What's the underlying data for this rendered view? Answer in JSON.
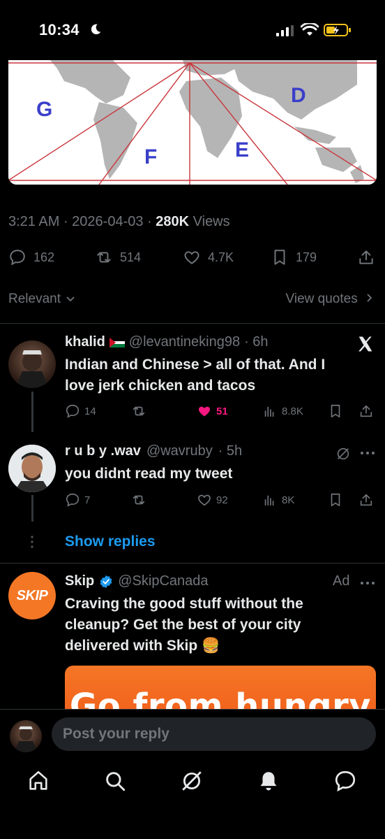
{
  "status": {
    "time": "10:34"
  },
  "map": {
    "labels": {
      "g": "G",
      "d": "D",
      "f": "F",
      "e": "E"
    }
  },
  "post": {
    "time": "3:21 AM",
    "date": "2026-04-03",
    "views_count": "280K",
    "views_label": "Views",
    "replies": "162",
    "reposts": "514",
    "likes": "4.7K",
    "bookmarks": "179"
  },
  "sort": {
    "label": "Relevant",
    "view_quotes": "View quotes"
  },
  "replies": [
    {
      "name": "khalid",
      "handle": "@levantineking98",
      "time": "· 6h",
      "text_line1": "Indian and Chinese > all of that. And I",
      "text_line2": "love jerk chicken and tacos",
      "reply_count": "14",
      "like_count": "51",
      "views": "8.8K"
    },
    {
      "name": "r u b y .wav",
      "handle": "@wavruby",
      "time": "· 5h",
      "text_line1": "you didnt read my tweet",
      "reply_count": "7",
      "like_count": "92",
      "views": "8K"
    }
  ],
  "show_replies": "Show replies",
  "ad": {
    "name": "Skip",
    "handle": "@SkipCanada",
    "ad_label": "Ad",
    "logo_text": "SKIP",
    "text_line1": "Craving the good stuff without the",
    "text_line2": "cleanup? Get the best of your city",
    "text_line3": "delivered with Skip 🍔",
    "promo_text": "Go from hungry"
  },
  "composer": {
    "placeholder": "Post your reply"
  },
  "colors": {
    "accent": "#1d9bf0",
    "like": "#f91880",
    "skip": "#f47726"
  }
}
